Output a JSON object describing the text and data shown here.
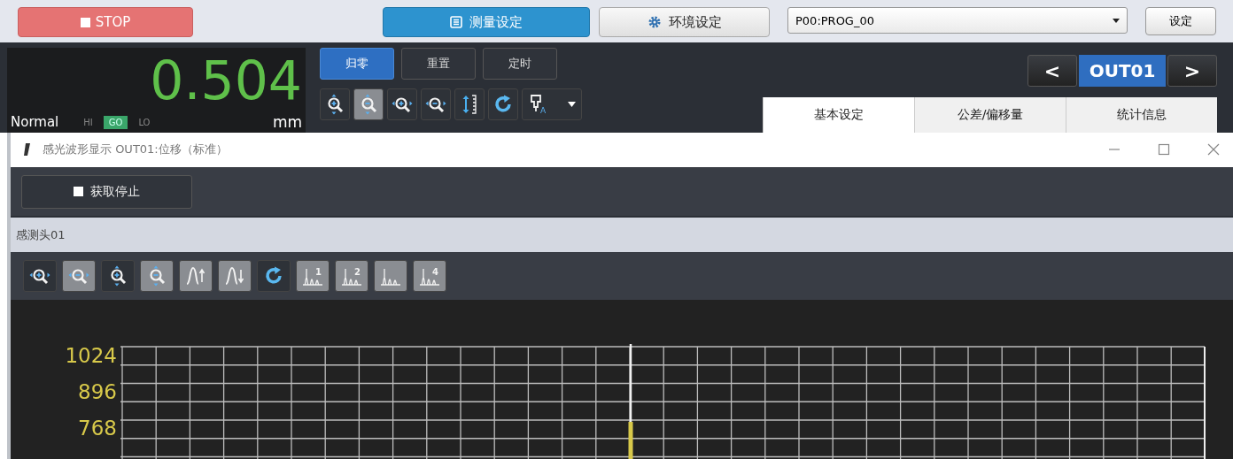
{
  "top_bar": {
    "stop_button": {
      "label": "STOP"
    },
    "tabs": [
      {
        "label": "测量设定",
        "selected": true
      },
      {
        "label": "环境设定",
        "selected": false
      }
    ],
    "program_select": {
      "value": "P00:PROG_00"
    },
    "settings_button": {
      "label": "设定"
    }
  },
  "display": {
    "value": "0.504",
    "mode": "Normal",
    "unit": "mm",
    "judgements": [
      {
        "label": "HI",
        "lit": false
      },
      {
        "label": "GO",
        "lit": true
      },
      {
        "label": "LO",
        "lit": false
      }
    ]
  },
  "action_buttons": [
    {
      "label": "归零",
      "selected": true
    },
    {
      "label": "重置",
      "selected": false
    },
    {
      "label": "定时",
      "selected": false
    }
  ],
  "view_tools": [
    {
      "kind": "zoom-in-vertical",
      "pressed": false
    },
    {
      "kind": "zoom-out-vertical",
      "pressed": true
    },
    {
      "kind": "zoom-in-horizontal",
      "pressed": false
    },
    {
      "kind": "zoom-out-horizontal",
      "pressed": false
    },
    {
      "kind": "range",
      "pressed": false
    },
    {
      "kind": "refresh",
      "pressed": false
    },
    {
      "kind": "probe",
      "pressed": false,
      "label": "A"
    }
  ],
  "output_selector": {
    "prev": "<",
    "value": "OUT01",
    "next": ">"
  },
  "setting_tabs": [
    {
      "label": "基本设定",
      "selected": true
    },
    {
      "label": "公差/偏移量",
      "selected": false
    },
    {
      "label": "统计信息",
      "selected": false
    }
  ],
  "waveform_window": {
    "title": "感光波形显示 OUT01:位移（标准）",
    "capture_button": {
      "label": "获取停止"
    },
    "sensor_head": "感测头01",
    "tools": [
      {
        "kind": "zoom-in-horizontal",
        "pressed": false
      },
      {
        "kind": "zoom-out-horizontal",
        "pressed": true
      },
      {
        "kind": "zoom-in-vertical",
        "pressed": false
      },
      {
        "kind": "zoom-out-vertical",
        "pressed": true
      },
      {
        "kind": "peak-up",
        "pressed": true
      },
      {
        "kind": "peak-down",
        "pressed": true
      },
      {
        "kind": "refresh",
        "pressed": false
      },
      {
        "kind": "peaks",
        "pressed": true,
        "label": "1"
      },
      {
        "kind": "peaks",
        "pressed": true,
        "label": "2"
      },
      {
        "kind": "peaks",
        "pressed": true
      },
      {
        "kind": "peaks",
        "pressed": true,
        "label": "4"
      }
    ],
    "y_axis_labels": [
      "1024",
      "896",
      "768"
    ]
  }
}
